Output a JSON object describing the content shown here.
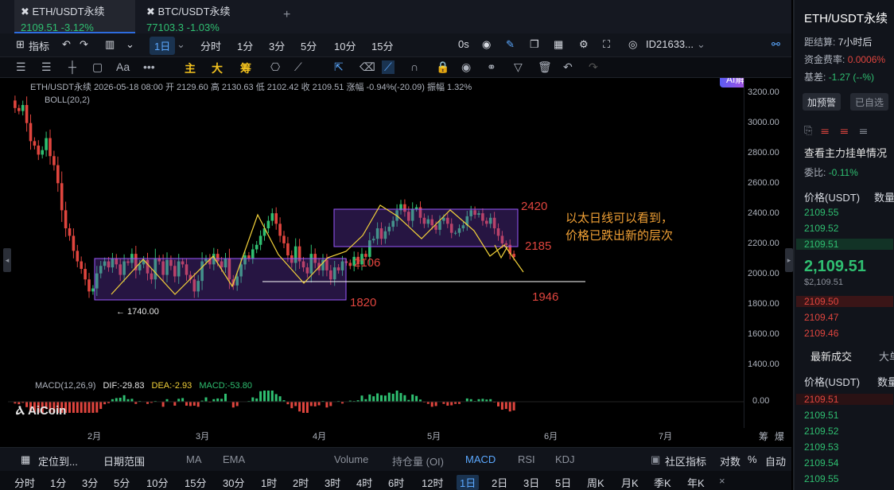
{
  "tabs": [
    {
      "name": "ETH/USDT永续",
      "price": "2109.51",
      "change": "-3.12%"
    },
    {
      "name": "BTC/USDT永续",
      "price": "77103.3",
      "change": "-1.03%"
    }
  ],
  "new_tab": "+",
  "toolbar": {
    "indicators": "指标",
    "timeframe": "1日",
    "intervals": [
      "分时",
      "1分",
      "3分",
      "5分",
      "10分",
      "15分"
    ],
    "delay": "0s",
    "account": "ID21633...",
    "ai": "AI解读"
  },
  "drawbar": {
    "labels": [
      "主",
      "大",
      "筹"
    ]
  },
  "ohlc": "ETH/USDT永续  2026-05-18 08:00  开 2129.60  高 2130.63  低 2102.42  收 2109.51  涨幅 -0.94%(-20.09)  振幅 1.32%",
  "boll": "BOLL(20,2)",
  "macd_label": {
    "name": "MACD(12,26,9)",
    "dif": "DIF:-29.83",
    "dea": "DEA:-2.93",
    "macd": "MACD:-53.80"
  },
  "watermark": "AiCoin",
  "y_axis": [
    "3200.00",
    "3000.00",
    "2800.00",
    "2600.00",
    "2400.00",
    "2200.00",
    "2000.00",
    "1800.00",
    "1600.00",
    "1400.00"
  ],
  "macd_axis": "0.00",
  "x_axis": [
    "2月",
    "3月",
    "4月",
    "5月",
    "6月",
    "7月"
  ],
  "axis_corner": [
    "筹",
    "爆"
  ],
  "annotations": {
    "r2420": "2420",
    "r2185": "2185",
    "r2106": "2106",
    "r1820": "1820",
    "r1946": "1946",
    "low": "← 1740.00",
    "note": [
      "以太日线可以看到，",
      "价格已跌出新的层次"
    ]
  },
  "bottom_bar": {
    "locate": "定位到...",
    "range": "日期范围",
    "indicators": [
      "MA",
      "EMA",
      "Volume",
      "持仓量 (OI)",
      "MACD",
      "RSI",
      "KDJ"
    ],
    "community": "社区指标",
    "log": "对数",
    "pct": "%",
    "auto": "自动"
  },
  "timeframes": [
    "分时",
    "1分",
    "3分",
    "5分",
    "10分",
    "15分",
    "30分",
    "1时",
    "2时",
    "3时",
    "4时",
    "6时",
    "12时",
    "1日",
    "2日",
    "3日",
    "5日",
    "周K",
    "月K",
    "季K",
    "年K"
  ],
  "sidebar": {
    "title": "ETH/USDT永续",
    "settle_label": "距结算:",
    "settle": "7小时后",
    "funding_label": "资金费率:",
    "funding": "0.0006%",
    "basis_label": "基差:",
    "basis": "-1.27 (--%)",
    "alert": "加预警",
    "watch": "已自选",
    "orderbook": "查看主力挂单情况",
    "ratio_label": "委比:",
    "ratio": "-0.11%",
    "col_price": "价格(USDT)",
    "col_qty": "数量",
    "asks": [
      "2109.55",
      "2109.52",
      "2109.51"
    ],
    "last": "2,109.51",
    "last_usd": "$2,109.51",
    "bids": [
      "2109.50",
      "2109.47",
      "2109.46"
    ],
    "trades_tab": "最新成交",
    "big_tab": "大单",
    "trades": [
      "2109.51",
      "2109.51",
      "2109.52",
      "2109.53",
      "2109.54",
      "2109.55"
    ]
  },
  "chart_data": {
    "type": "candlestick",
    "y_range": [
      1300,
      3300
    ],
    "closes": [
      3150,
      3100,
      3080,
      3120,
      3000,
      2880,
      2850,
      2790,
      2820,
      2900,
      2780,
      2720,
      2600,
      2420,
      2300,
      2250,
      2150,
      2080,
      2030,
      1960,
      1880,
      1900,
      2000,
      2050,
      2080,
      2040,
      2100,
      2060,
      1990,
      2080,
      2070,
      2130,
      2020,
      2060,
      2090,
      2000,
      1960,
      2100,
      2080,
      1990,
      2090,
      2050,
      1980,
      2080,
      2060,
      1990,
      1960,
      1880,
      1950,
      2080,
      2100,
      2060,
      2130,
      2080,
      2040,
      2100,
      1960,
      1920,
      1980,
      2060,
      2120,
      2100,
      2160,
      2190,
      2250,
      2300,
      2350,
      2400,
      2330,
      2250,
      2200,
      2120,
      2070,
      2180,
      2080,
      2040,
      2000,
      2130,
      2070,
      2020,
      2090,
      2020,
      1960,
      2040,
      2020,
      2080,
      2070,
      2050,
      2110,
      2060,
      2130,
      2110,
      2220,
      2230,
      2300,
      2230,
      2280,
      2310,
      2350,
      2420,
      2460,
      2410,
      2350,
      2430,
      2440,
      2370,
      2330,
      2360,
      2320,
      2290,
      2350,
      2370,
      2330,
      2270,
      2270,
      2300,
      2320,
      2380,
      2420,
      2390,
      2400,
      2350,
      2330,
      2370,
      2300,
      2250,
      2200,
      2190,
      2130,
      2109
    ]
  }
}
